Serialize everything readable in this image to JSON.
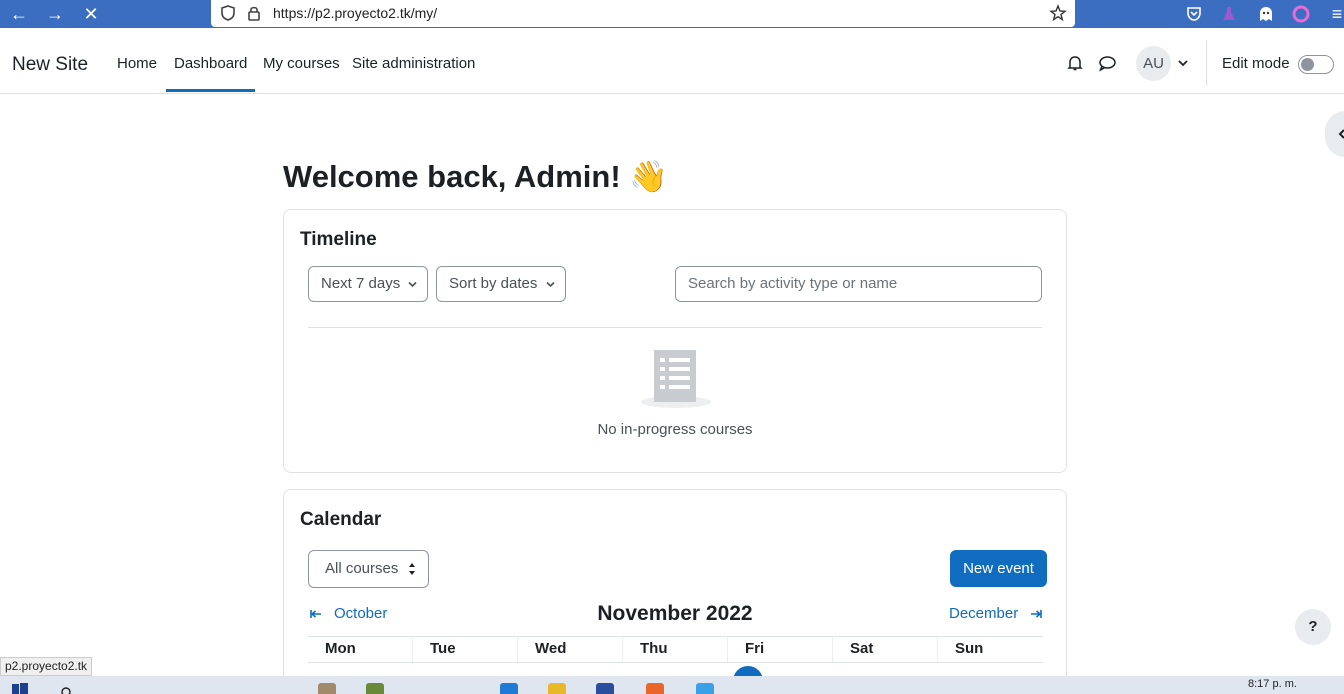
{
  "browser": {
    "url": "https://p2.proyecto2.tk/my/",
    "status_url": "p2.proyecto2.tk"
  },
  "navbar": {
    "brand": "New Site",
    "links": [
      "Home",
      "Dashboard",
      "My courses",
      "Site administration"
    ],
    "active_link": "Dashboard",
    "avatar_initials": "AU",
    "edit_mode_label": "Edit mode",
    "edit_mode_on": false
  },
  "welcome": {
    "text": "Welcome back, Admin!",
    "emoji": "👋"
  },
  "timeline": {
    "title": "Timeline",
    "filter_label": "Next 7 days",
    "sort_label": "Sort by dates",
    "search_placeholder": "Search by activity type or name",
    "empty_message": "No in-progress courses"
  },
  "calendar": {
    "title": "Calendar",
    "course_filter": "All courses",
    "new_event_label": "New event",
    "prev_month": "October",
    "current_month": "November 2022",
    "next_month": "December",
    "days": [
      "Mon",
      "Tue",
      "Wed",
      "Thu",
      "Fri",
      "Sat",
      "Sun"
    ]
  },
  "help_label": "?",
  "taskbar": {
    "time": "8:17 p. m."
  },
  "colors": {
    "primary": "#0f6cbf",
    "browser_bar": "#3b6ec0",
    "border": "#dee2e6"
  }
}
